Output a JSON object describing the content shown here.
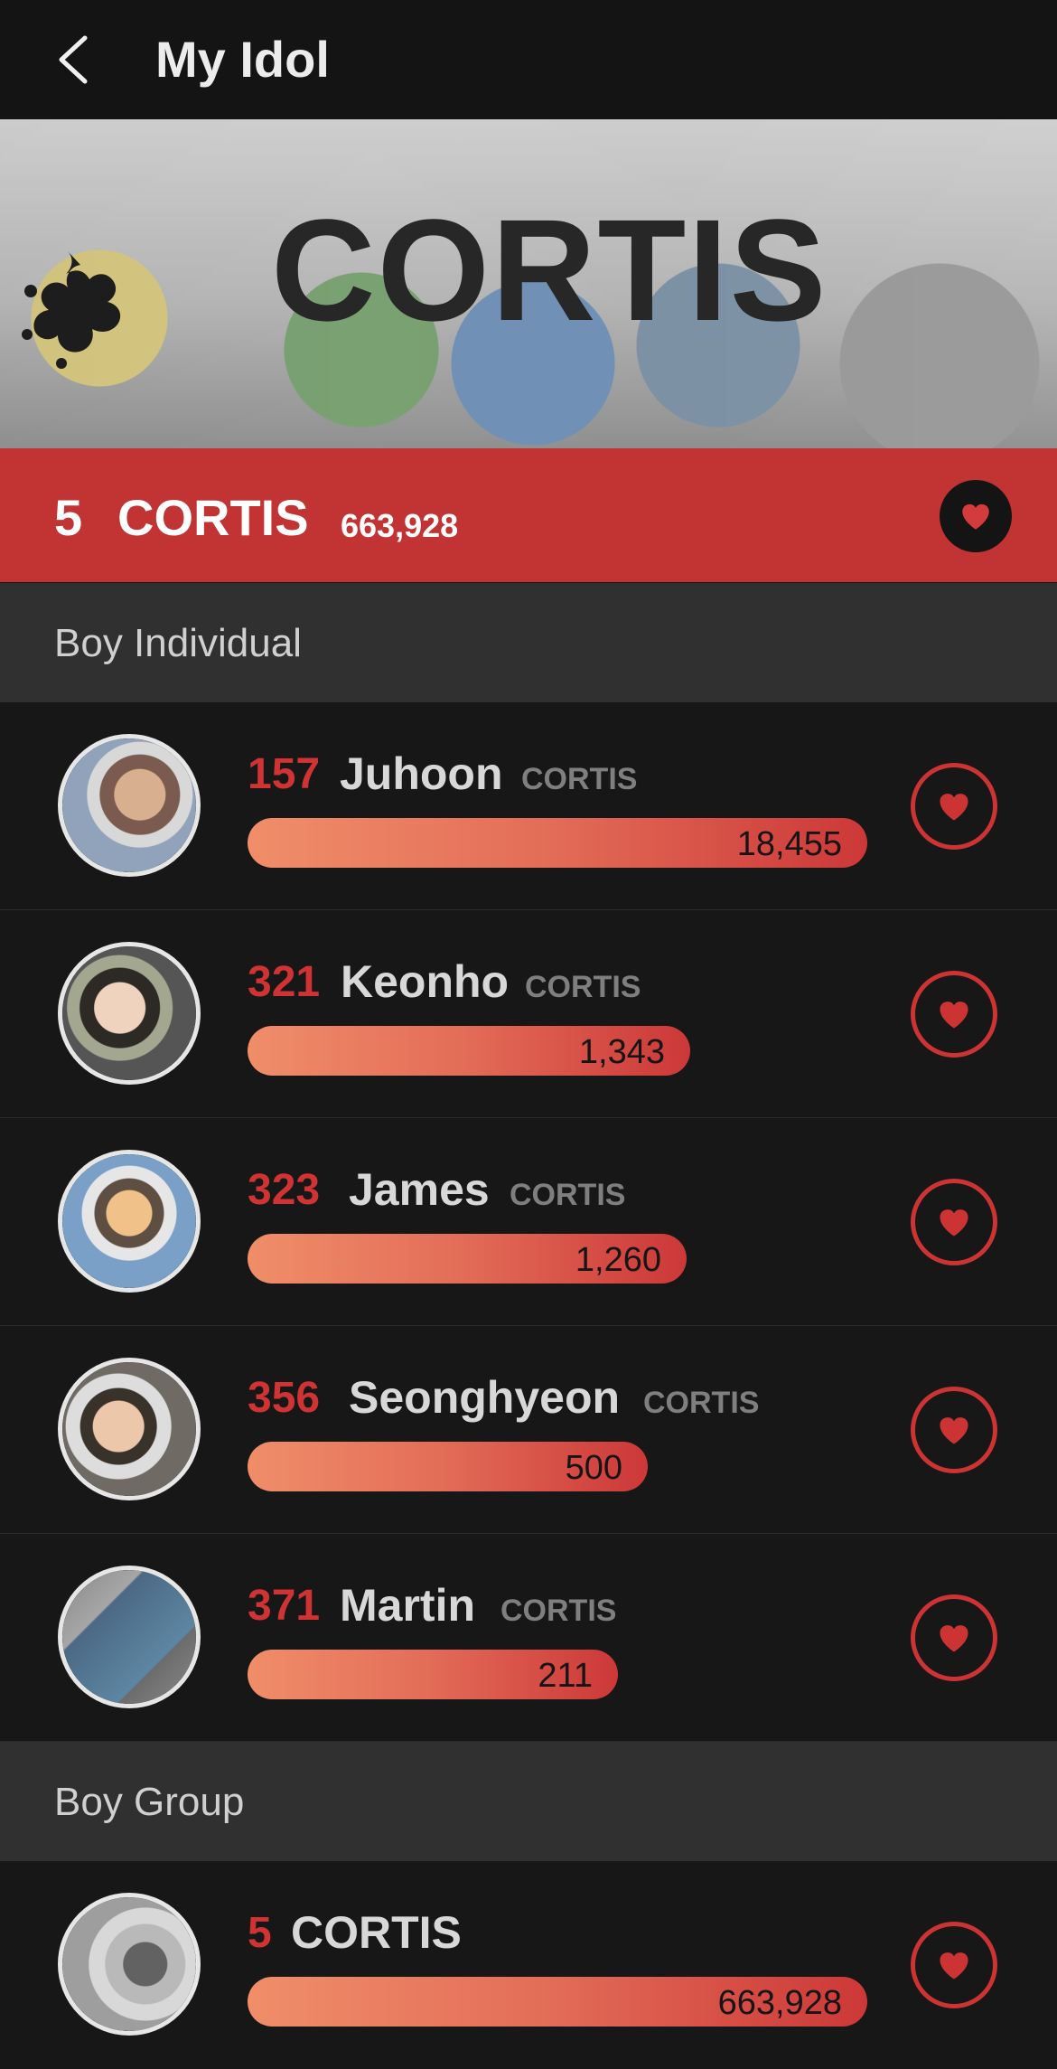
{
  "header": {
    "title": "My Idol"
  },
  "hero": {
    "title": "CORTIS"
  },
  "group_banner": {
    "rank": "5",
    "name": "CORTIS",
    "votes": "663,928"
  },
  "sections": [
    {
      "label": "Boy Individual",
      "items": [
        {
          "rank": "157",
          "name": "Juhoon",
          "group": "CORTIS",
          "votes": "18,455",
          "progress": 1.0
        },
        {
          "rank": "321",
          "name": "Keonho",
          "group": "CORTIS",
          "votes": "1,343",
          "progress": 0.71
        },
        {
          "rank": "323",
          "name": "James",
          "group": "CORTIS",
          "votes": "1,260",
          "progress": 0.71
        },
        {
          "rank": "356",
          "name": "Seonghyeon",
          "group": "CORTIS",
          "votes": "500",
          "progress": 0.65
        },
        {
          "rank": "371",
          "name": "Martin",
          "group": "CORTIS",
          "votes": "211",
          "progress": 0.6
        }
      ]
    },
    {
      "label": "Boy Group",
      "items": [
        {
          "rank": "5",
          "name": "CORTIS",
          "group": "",
          "votes": "663,928",
          "progress": 1.0
        }
      ]
    }
  ],
  "colors": {
    "accent": "#cc3333",
    "bar_start": "#f08e69",
    "bar_end": "#cc3838",
    "background": "#171717"
  },
  "icons": {
    "back": "chevron-left-icon",
    "heart": "heart-icon"
  }
}
